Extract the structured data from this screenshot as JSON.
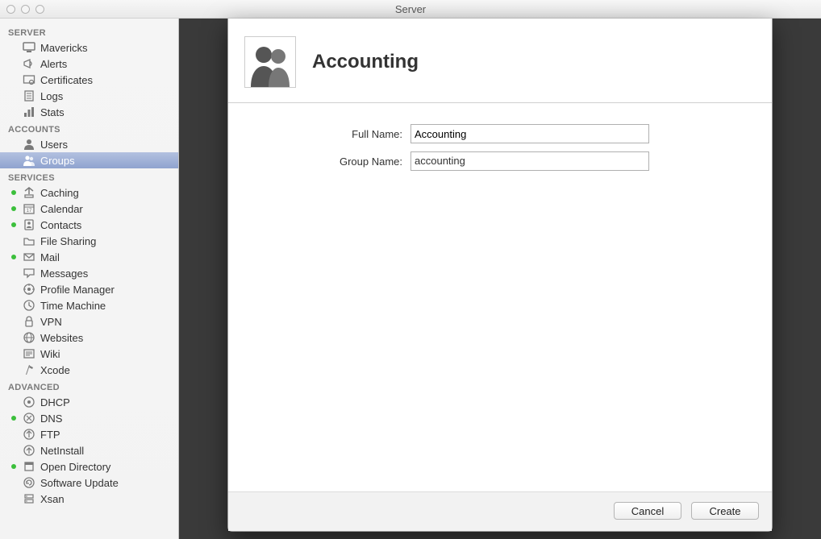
{
  "window": {
    "title": "Server"
  },
  "sidebar": {
    "sections": [
      {
        "header": "SERVER",
        "items": [
          {
            "label": "Mavericks",
            "icon": "monitor-icon",
            "dot": false
          },
          {
            "label": "Alerts",
            "icon": "megaphone-icon",
            "dot": false
          },
          {
            "label": "Certificates",
            "icon": "certificate-icon",
            "dot": false
          },
          {
            "label": "Logs",
            "icon": "log-icon",
            "dot": false
          },
          {
            "label": "Stats",
            "icon": "stats-icon",
            "dot": false
          }
        ]
      },
      {
        "header": "ACCOUNTS",
        "items": [
          {
            "label": "Users",
            "icon": "user-icon",
            "dot": false
          },
          {
            "label": "Groups",
            "icon": "group-icon",
            "dot": false,
            "selected": true
          }
        ]
      },
      {
        "header": "SERVICES",
        "items": [
          {
            "label": "Caching",
            "icon": "caching-icon",
            "dot": true
          },
          {
            "label": "Calendar",
            "icon": "calendar-icon",
            "dot": true
          },
          {
            "label": "Contacts",
            "icon": "contacts-icon",
            "dot": true
          },
          {
            "label": "File Sharing",
            "icon": "filesharing-icon",
            "dot": false
          },
          {
            "label": "Mail",
            "icon": "mail-icon",
            "dot": true
          },
          {
            "label": "Messages",
            "icon": "messages-icon",
            "dot": false
          },
          {
            "label": "Profile Manager",
            "icon": "profilemanager-icon",
            "dot": false
          },
          {
            "label": "Time Machine",
            "icon": "timemachine-icon",
            "dot": false
          },
          {
            "label": "VPN",
            "icon": "vpn-icon",
            "dot": false
          },
          {
            "label": "Websites",
            "icon": "websites-icon",
            "dot": false
          },
          {
            "label": "Wiki",
            "icon": "wiki-icon",
            "dot": false
          },
          {
            "label": "Xcode",
            "icon": "xcode-icon",
            "dot": false
          }
        ]
      },
      {
        "header": "ADVANCED",
        "items": [
          {
            "label": "DHCP",
            "icon": "dhcp-icon",
            "dot": false
          },
          {
            "label": "DNS",
            "icon": "dns-icon",
            "dot": true
          },
          {
            "label": "FTP",
            "icon": "ftp-icon",
            "dot": false
          },
          {
            "label": "NetInstall",
            "icon": "netinstall-icon",
            "dot": false
          },
          {
            "label": "Open Directory",
            "icon": "opendirectory-icon",
            "dot": true
          },
          {
            "label": "Software Update",
            "icon": "softwareupdate-icon",
            "dot": false
          },
          {
            "label": "Xsan",
            "icon": "xsan-icon",
            "dot": false
          }
        ]
      }
    ]
  },
  "sheet": {
    "title": "Accounting",
    "fields": {
      "full_name": {
        "label": "Full Name:",
        "value": "Accounting"
      },
      "group_name": {
        "label": "Group Name:",
        "value": "accounting"
      }
    },
    "buttons": {
      "cancel": "Cancel",
      "create": "Create"
    }
  }
}
